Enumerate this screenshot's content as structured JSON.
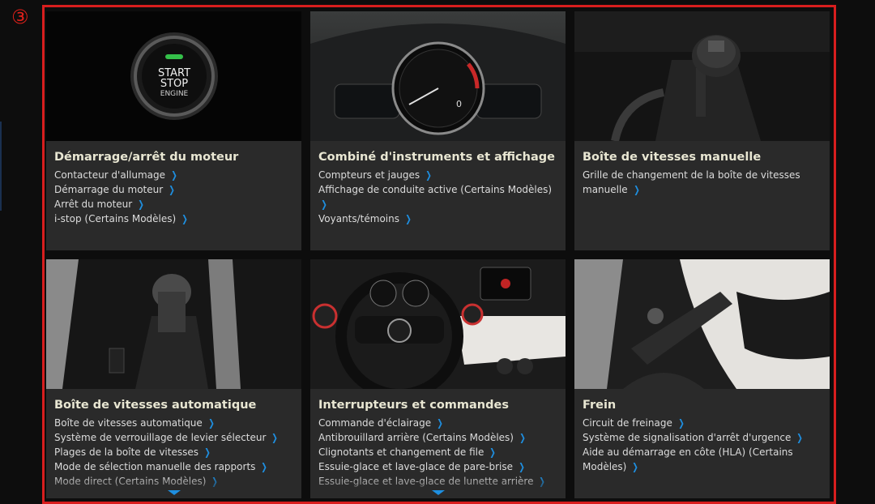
{
  "marker": "③",
  "cards": [
    {
      "title": "Démarrage/arrêt du moteur",
      "links": [
        "Contacteur d'allumage",
        "Démarrage du moteur",
        "Arrêt du moteur",
        "i-stop (Certains Modèles)"
      ],
      "image_text": {
        "line1": "START",
        "line2": "STOP",
        "line3": "ENGINE"
      }
    },
    {
      "title": "Combiné d'instruments et affichage",
      "links": [
        "Compteurs et jauges",
        "Affichage de conduite active (Certains Modèles)",
        "Voyants/témoins"
      ]
    },
    {
      "title": "Boîte de vitesses manuelle",
      "links": [
        "Grille de changement de la boîte de vitesses manuelle"
      ]
    },
    {
      "title": "Boîte de vitesses automatique",
      "links": [
        "Boîte de vitesses automatique",
        "Système de verrouillage de levier sélecteur",
        "Plages de la boîte de vitesses",
        "Mode de sélection manuelle des rapports",
        "Mode direct (Certains Modèles)"
      ]
    },
    {
      "title": "Interrupteurs et commandes",
      "links": [
        "Commande d'éclairage",
        "Antibrouillard arrière (Certains Modèles)",
        "Clignotants et changement de file",
        "Essuie-glace et lave-glace de pare-brise",
        "Essuie-glace et lave-glace de lunette arrière"
      ]
    },
    {
      "title": "Frein",
      "links": [
        "Circuit de freinage",
        "Système de signalisation d'arrêt d'urgence",
        "Aide au démarrage en côte (HLA) (Certains Modèles)"
      ]
    }
  ],
  "colors": {
    "frame": "#d81e1e",
    "chevron": "#1e8fe0",
    "title": "#e8e6d2",
    "card_bg": "#2a2a2a"
  },
  "icons": {
    "link_chevron": "chevron-right-icon",
    "scroll_more": "chevron-down-icon"
  }
}
